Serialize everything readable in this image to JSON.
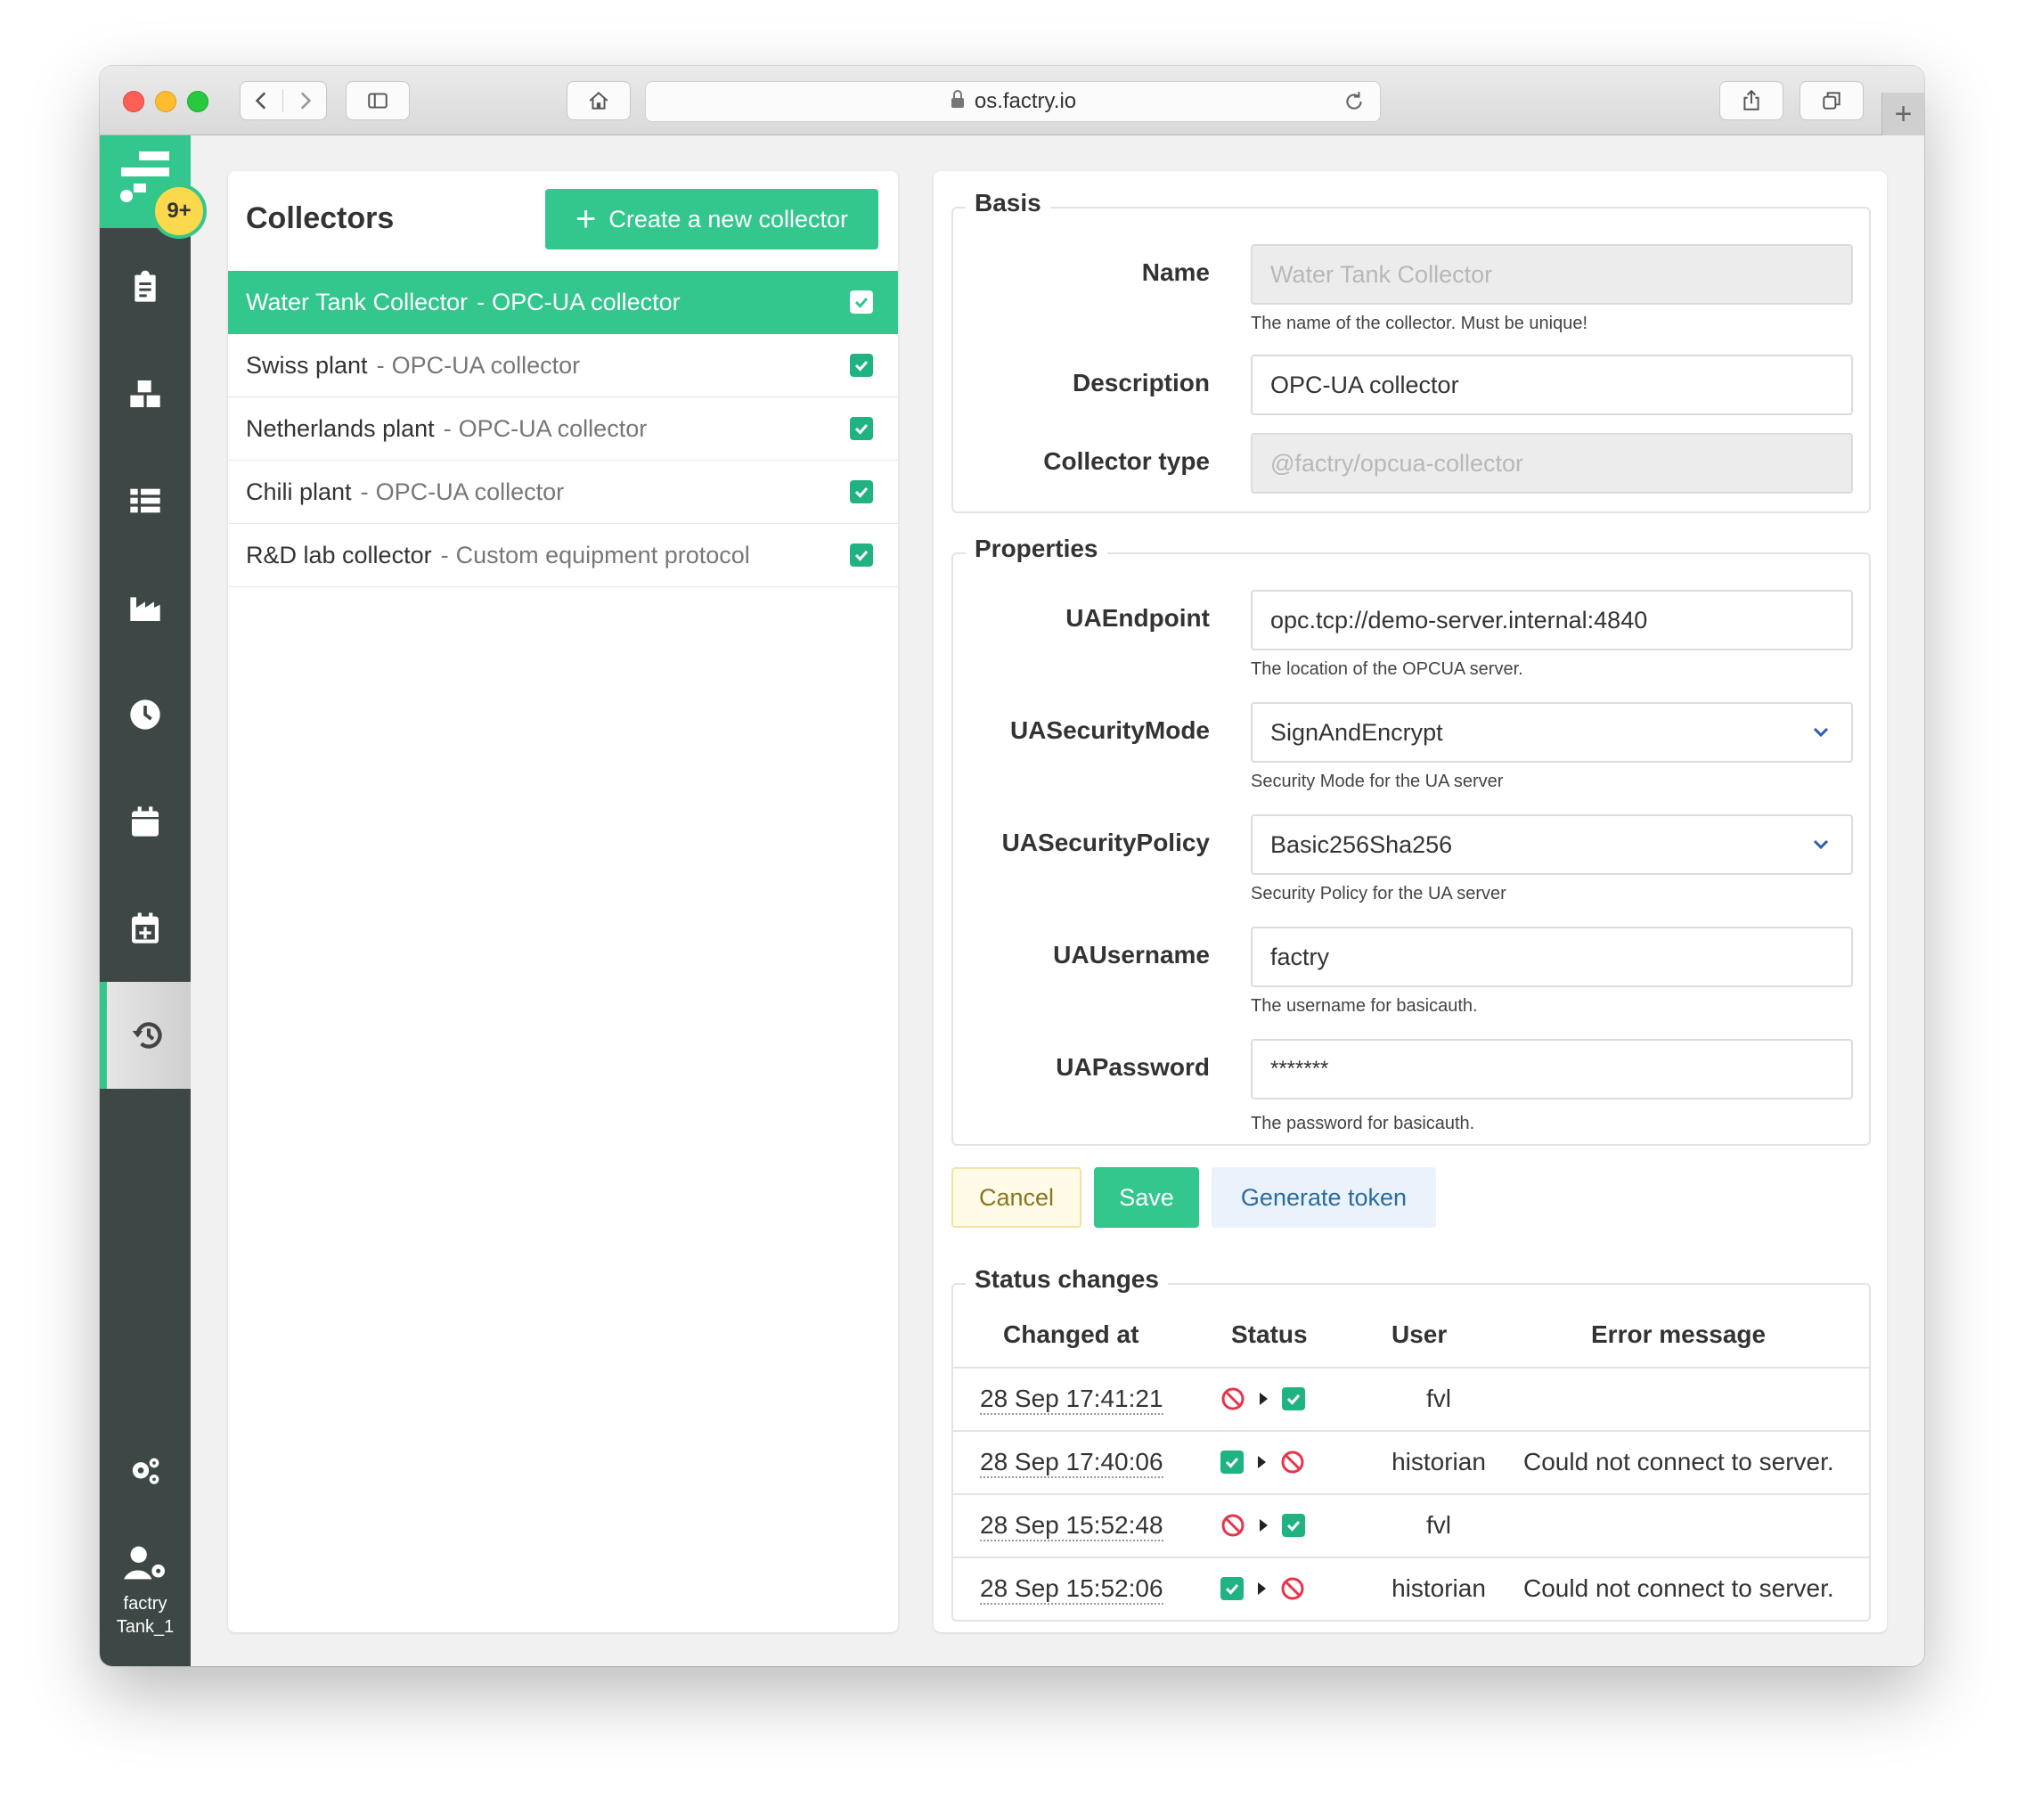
{
  "browser": {
    "url": "os.factry.io"
  },
  "sidebar": {
    "badge": "9+",
    "user_line1": "factry",
    "user_line2": "Tank_1",
    "icons": [
      "clipboard-icon",
      "boxes-icon",
      "list-icon",
      "factory-icon",
      "clock-icon",
      "calendar-icon",
      "calendar-plus-icon",
      "history-icon",
      "gears-icon",
      "user-gear-icon"
    ]
  },
  "collectors_panel": {
    "title": "Collectors",
    "create_button": "Create a new collector",
    "items": [
      {
        "name": "Water Tank Collector",
        "type": "OPC-UA collector",
        "enabled": true,
        "selected": true
      },
      {
        "name": "Swiss plant",
        "type": "OPC-UA collector",
        "enabled": true,
        "selected": false
      },
      {
        "name": "Netherlands plant",
        "type": "OPC-UA collector",
        "enabled": true,
        "selected": false
      },
      {
        "name": "Chili plant",
        "type": "OPC-UA collector",
        "enabled": true,
        "selected": false
      },
      {
        "name": "R&D lab collector",
        "type": "Custom equipment protocol",
        "enabled": true,
        "selected": false
      }
    ],
    "separator": "-"
  },
  "basis": {
    "legend": "Basis",
    "name_label": "Name",
    "name_placeholder": "Water Tank Collector",
    "name_help": "The name of the collector. Must be unique!",
    "description_label": "Description",
    "description_value": "OPC-UA collector",
    "type_label": "Collector type",
    "type_value": "@factry/opcua-collector"
  },
  "properties": {
    "legend": "Properties",
    "endpoint_label": "UAEndpoint",
    "endpoint_value": "opc.tcp://demo-server.internal:4840",
    "endpoint_help": "The location of the OPCUA server.",
    "mode_label": "UASecurityMode",
    "mode_value": "SignAndEncrypt",
    "mode_help": "Security Mode for the UA server",
    "policy_label": "UASecurityPolicy",
    "policy_value": "Basic256Sha256",
    "policy_help": "Security Policy for the UA server",
    "username_label": "UAUsername",
    "username_value": "factry",
    "username_help": "The username for basicauth.",
    "password_label": "UAPassword",
    "password_value": "*******",
    "password_help": "The password for basicauth."
  },
  "actions": {
    "cancel": "Cancel",
    "save": "Save",
    "generate_token": "Generate token"
  },
  "status_changes": {
    "legend": "Status changes",
    "headers": {
      "changed_at": "Changed at",
      "status": "Status",
      "user": "User",
      "error": "Error message"
    },
    "rows": [
      {
        "changed_at": "28 Sep 17:41:21",
        "from": "disabled",
        "to": "enabled",
        "user": "fvl",
        "error": ""
      },
      {
        "changed_at": "28 Sep 17:40:06",
        "from": "enabled",
        "to": "disabled",
        "user": "historian",
        "error": "Could not connect to server."
      },
      {
        "changed_at": "28 Sep 15:52:48",
        "from": "disabled",
        "to": "enabled",
        "user": "fvl",
        "error": ""
      },
      {
        "changed_at": "28 Sep 15:52:06",
        "from": "enabled",
        "to": "disabled",
        "user": "historian",
        "error": "Could not connect to server."
      }
    ]
  },
  "colors": {
    "brand_green": "#33c68d",
    "sidebar_dark": "#3d4846",
    "badge_yellow": "#fbd94c",
    "error_red": "#e8334a"
  }
}
